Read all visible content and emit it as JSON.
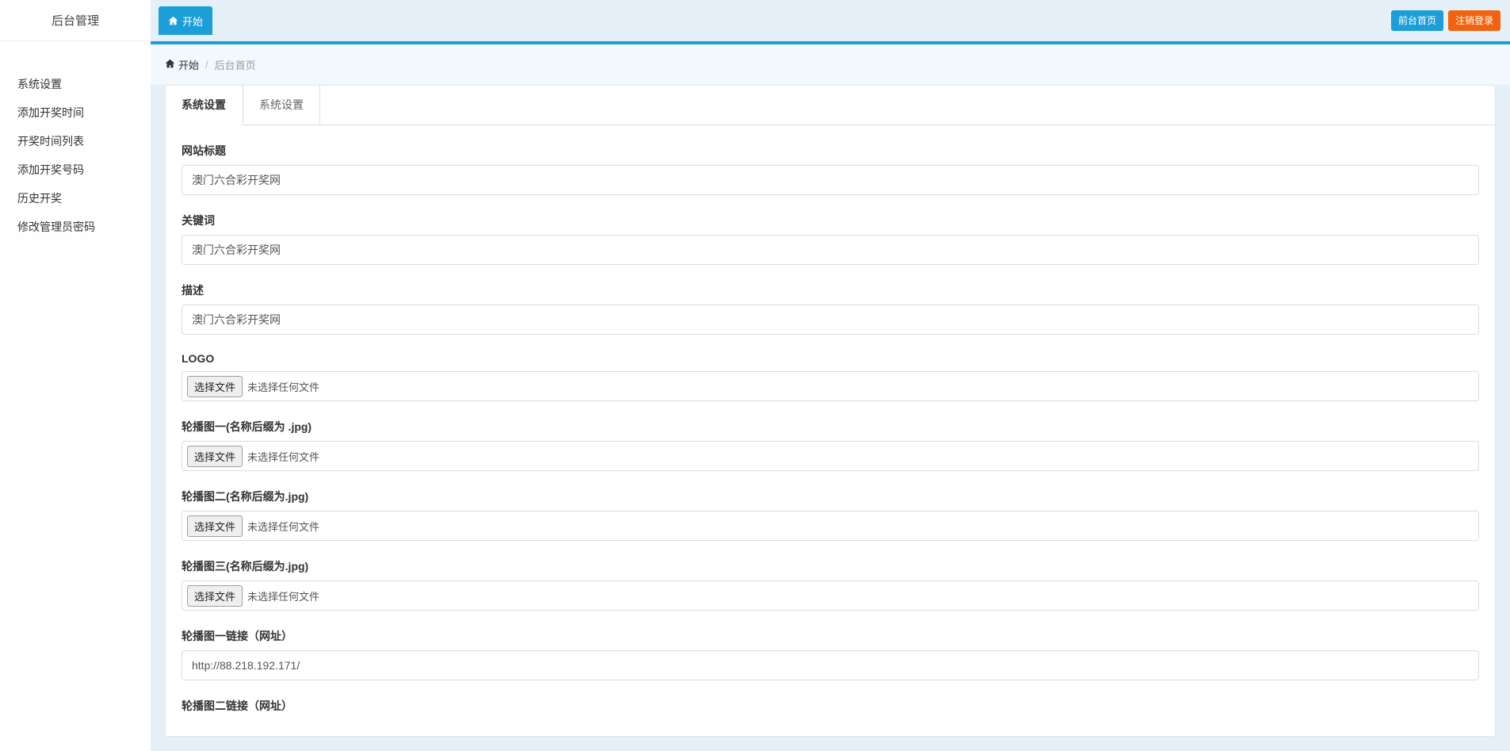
{
  "sidebar": {
    "title": "后台管理",
    "items": [
      {
        "label": "系统设置"
      },
      {
        "label": "添加开奖时间"
      },
      {
        "label": "开奖时间列表"
      },
      {
        "label": "添加开奖号码"
      },
      {
        "label": "历史开奖"
      },
      {
        "label": "修改管理员密码"
      }
    ]
  },
  "topbar": {
    "tab_start": "开始",
    "front_page": "前台首页",
    "logout": "注销登录"
  },
  "breadcrumb": {
    "home": "开始",
    "current": "后台首页"
  },
  "tabs": {
    "tab1": "系统设置",
    "tab2": "系统设置"
  },
  "form": {
    "site_title": {
      "label": "网站标题",
      "value": "澳门六合彩开奖网"
    },
    "keywords": {
      "label": "关键词",
      "value": "澳门六合彩开奖网"
    },
    "description": {
      "label": "描述",
      "value": "澳门六合彩开奖网"
    },
    "logo": {
      "label": "LOGO",
      "button": "选择文件",
      "no_file": "未选择任何文件"
    },
    "carousel1": {
      "label": "轮播图一(名称后缀为 .jpg)",
      "button": "选择文件",
      "no_file": "未选择任何文件"
    },
    "carousel2": {
      "label": "轮播图二(名称后缀为.jpg)",
      "button": "选择文件",
      "no_file": "未选择任何文件"
    },
    "carousel3": {
      "label": "轮播图三(名称后缀为.jpg)",
      "button": "选择文件",
      "no_file": "未选择任何文件"
    },
    "carousel1_link": {
      "label": "轮播图一链接（网址）",
      "value": "http://88.218.192.171/"
    },
    "carousel2_link": {
      "label": "轮播图二链接（网址）"
    }
  }
}
